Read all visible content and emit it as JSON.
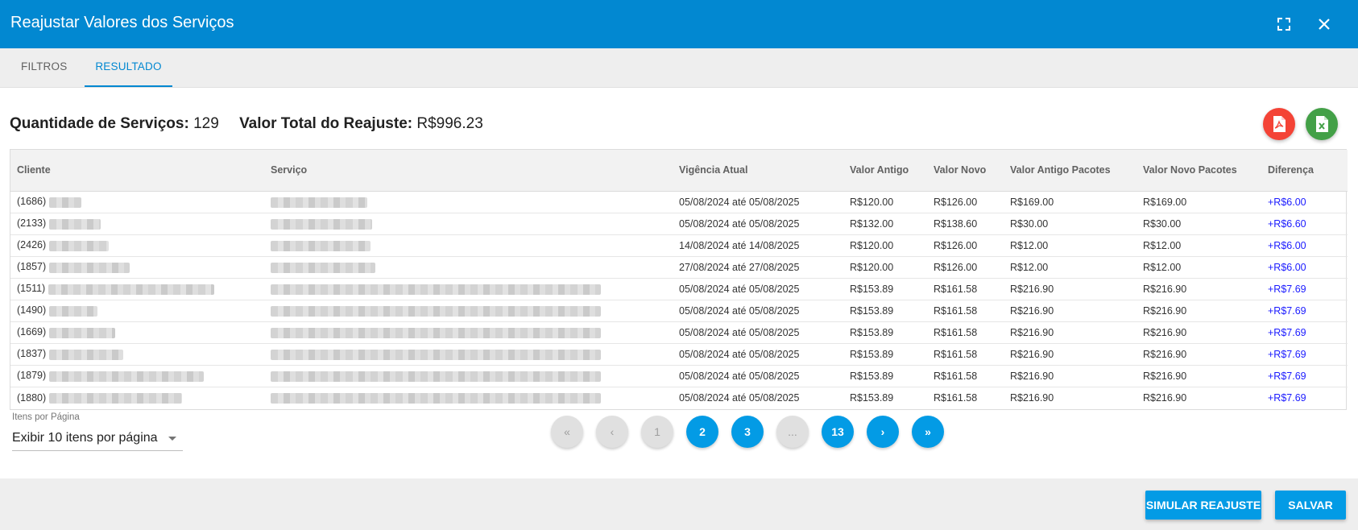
{
  "dialog": {
    "title": "Reajustar Valores dos Serviços",
    "maximize_icon": "fullscreen-icon",
    "close_icon": "close-icon"
  },
  "tabs": [
    {
      "label": "FILTROS"
    },
    {
      "label": "RESULTADO"
    }
  ],
  "summary": {
    "qty_label": "Quantidade de Serviços:",
    "qty_value": "129",
    "total_label": "Valor Total do Reajuste:",
    "total_value": "R$996.23"
  },
  "actions": {
    "pdf_icon": "pdf-icon",
    "excel_icon": "excel-icon",
    "pdf_color": "#f44336",
    "excel_color": "#43a047"
  },
  "table": {
    "headers": [
      "Cliente",
      "Serviço",
      "Vigência Atual",
      "Valor Antigo",
      "Valor Novo",
      "Valor Antigo Pacotes",
      "Valor Novo Pacotes",
      "Diferença"
    ],
    "rows": [
      [
        "(1686)",
        "",
        "05/08/2024 até 05/08/2025",
        "R$120.00",
        "R$126.00",
        "R$169.00",
        "R$169.00",
        "+R$6.00"
      ],
      [
        "(2133)",
        "",
        "05/08/2024 até 05/08/2025",
        "R$132.00",
        "R$138.60",
        "R$30.00",
        "R$30.00",
        "+R$6.60"
      ],
      [
        "(2426)",
        "",
        "14/08/2024 até 14/08/2025",
        "R$120.00",
        "R$126.00",
        "R$12.00",
        "R$12.00",
        "+R$6.00"
      ],
      [
        "(1857)",
        "",
        "27/08/2024 até 27/08/2025",
        "R$120.00",
        "R$126.00",
        "R$12.00",
        "R$12.00",
        "+R$6.00"
      ],
      [
        "(1511)",
        "",
        "05/08/2024 até 05/08/2025",
        "R$153.89",
        "R$161.58",
        "R$216.90",
        "R$216.90",
        "+R$7.69"
      ],
      [
        "(1490)",
        "",
        "05/08/2024 até 05/08/2025",
        "R$153.89",
        "R$161.58",
        "R$216.90",
        "R$216.90",
        "+R$7.69"
      ],
      [
        "(1669)",
        "",
        "05/08/2024 até 05/08/2025",
        "R$153.89",
        "R$161.58",
        "R$216.90",
        "R$216.90",
        "+R$7.69"
      ],
      [
        "(1837)",
        "",
        "05/08/2024 até 05/08/2025",
        "R$153.89",
        "R$161.58",
        "R$216.90",
        "R$216.90",
        "+R$7.69"
      ],
      [
        "(1879)",
        "",
        "05/08/2024 até 05/08/2025",
        "R$153.89",
        "R$161.58",
        "R$216.90",
        "R$216.90",
        "+R$7.69"
      ],
      [
        "(1880)",
        "",
        "05/08/2024 até 05/08/2025",
        "R$153.89",
        "R$161.58",
        "R$216.90",
        "R$216.90",
        "+R$7.69"
      ]
    ]
  },
  "pagination": {
    "items_label": "Itens por Página",
    "items_value": "Exibir 10 itens por página",
    "first": "«",
    "prev": "‹",
    "pages": [
      "1",
      "2",
      "3",
      "...",
      "13"
    ],
    "next": "›",
    "last": "»"
  },
  "footer": {
    "simulate_label": "SIMULAR REAJUSTE",
    "save_label": "SALVAR",
    "accent": "#039be5"
  }
}
